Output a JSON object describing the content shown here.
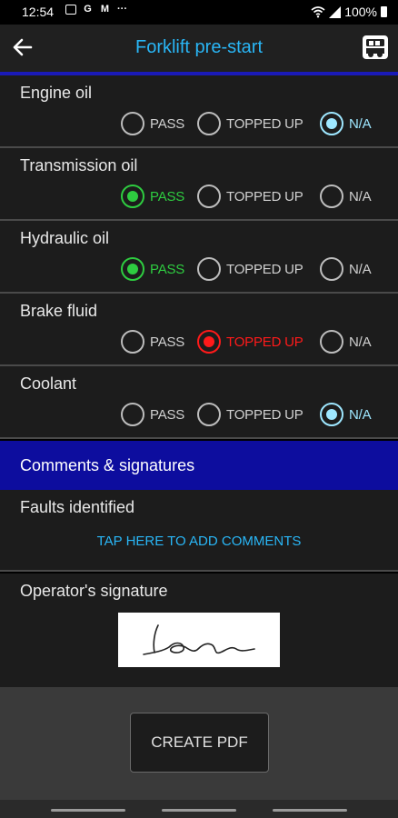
{
  "status_bar": {
    "time": "12:54",
    "battery": "100%",
    "icons": [
      "gallery-icon",
      "g-icon",
      "m-icon",
      "more-icon",
      "wifi-icon",
      "signal-icon",
      "battery-icon"
    ],
    "icon_glyphs": [
      "G",
      "M",
      "···"
    ]
  },
  "app_bar": {
    "title": "Forklift pre-start",
    "back_icon": "arrow-left-icon",
    "menu_icon": "forklift-icon"
  },
  "checklist": {
    "options": [
      "PASS",
      "TOPPED UP",
      "N/A"
    ],
    "items": [
      {
        "label": "Engine oil",
        "selected": "N/A"
      },
      {
        "label": "Transmission oil",
        "selected": "PASS"
      },
      {
        "label": "Hydraulic oil",
        "selected": "PASS"
      },
      {
        "label": "Brake fluid",
        "selected": "TOPPED UP"
      },
      {
        "label": "Coolant",
        "selected": "N/A"
      }
    ]
  },
  "comments": {
    "section_title": "Comments & signatures",
    "faults_label": "Faults identified",
    "faults_prompt": "TAP HERE TO ADD COMMENTS",
    "signature_label": "Operator's signature"
  },
  "actions": {
    "create_pdf": "CREATE PDF"
  },
  "colors": {
    "title": "#29b6f6",
    "pass": "#2ecc40",
    "topped_up": "#ff1a1a",
    "na": "#9ee7ff",
    "section_bg": "#0d0d9e",
    "accent_line": "#1a1ab8"
  }
}
